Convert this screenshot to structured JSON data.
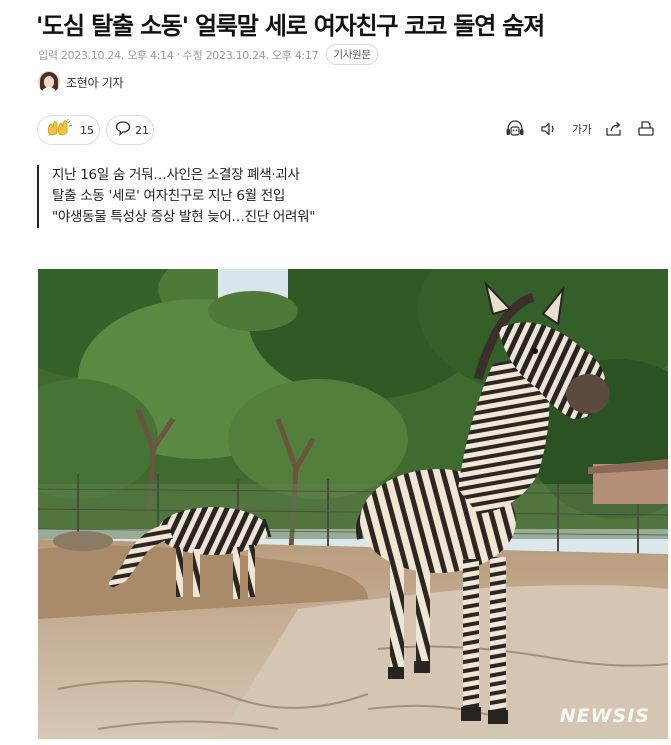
{
  "article": {
    "headline": "'도심 탈출 소동' 얼룩말 세로 여자친구 코코 돌연 숨져",
    "meta": {
      "published": "입력 2023.10.24. 오후 4:14",
      "separator": "·",
      "modified": "수정 2023.10.24. 오후 4:17",
      "original_link": "기사원문"
    },
    "reporter": {
      "name": "조현아 기자"
    },
    "reactions": [
      {
        "icon": "clap-hands-icon",
        "count": "15"
      },
      {
        "icon": "comment-icon",
        "count": "21"
      }
    ],
    "tools": {
      "audio": "headphone-robot-icon",
      "speaker": "speaker-icon",
      "font_size_label": "가가",
      "share": "share-icon",
      "print": "print-icon"
    },
    "summary": [
      "지난 16일 숨 거둬…사인은 소결장 폐색·괴사",
      "탈출 소동 '세로' 여자친구로 지난 6월 전입",
      "\"야생동물 특성상 증상 발현 늦어…진단 어려워\""
    ],
    "photo": {
      "watermark": "NEWSIS",
      "subject": "zebra-photo"
    }
  }
}
